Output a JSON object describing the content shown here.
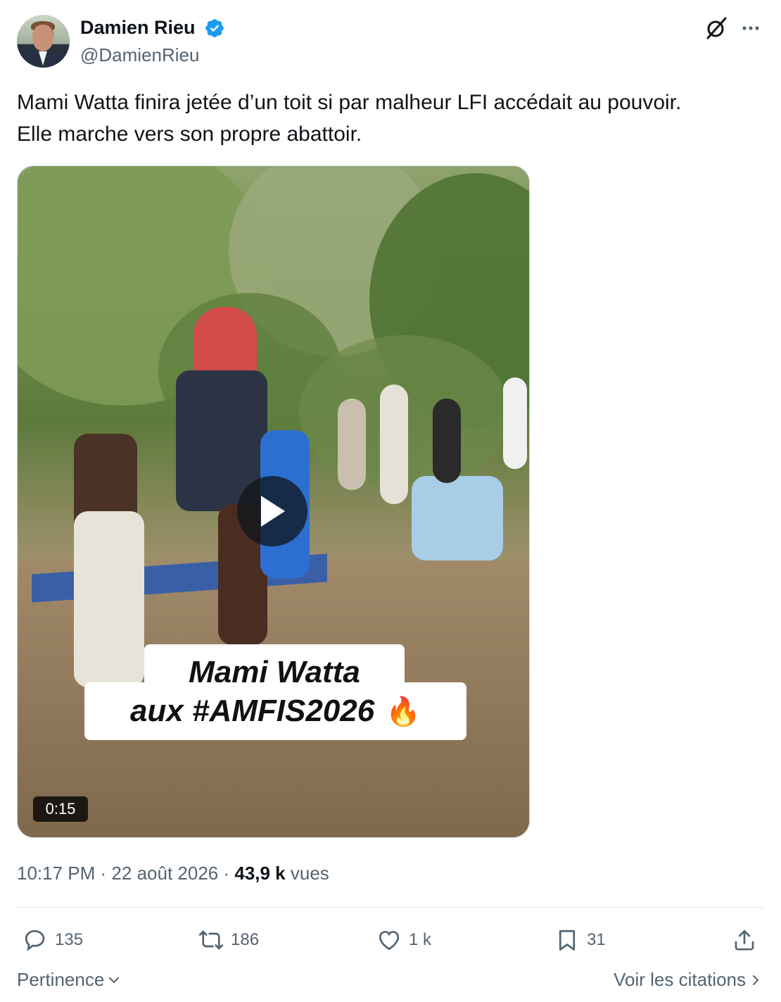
{
  "author": {
    "name": "Damien Rieu",
    "handle": "@DamienRieu",
    "verified": true
  },
  "tweet": {
    "lines": [
      "Mami Watta finira jetée d’un toit si par malheur LFI accédait au pouvoir.",
      "Elle marche vers son propre abattoir."
    ]
  },
  "media": {
    "caption_line1": "Mami Watta",
    "caption_line2": "aux #AMFIS2026",
    "caption_emoji": "🔥",
    "duration": "0:15"
  },
  "meta": {
    "time": "10:17 PM",
    "date": "22 août 2026",
    "views_count": "43,9 k",
    "views_label": "vues"
  },
  "actions": {
    "replies": "135",
    "reposts": "186",
    "likes": "1 k",
    "bookmarks": "31"
  },
  "footer": {
    "sort_label": "Pertinence",
    "quotes_label": "Voir les citations"
  },
  "colors": {
    "verified_blue": "#1d9bf0",
    "secondary_text": "#536471",
    "primary_text": "#0f1419"
  },
  "icons": [
    "grok-icon",
    "more-icon",
    "play-icon",
    "reply-icon",
    "repost-icon",
    "like-icon",
    "bookmark-icon",
    "share-icon",
    "chevron-down-icon",
    "chevron-right-icon"
  ]
}
